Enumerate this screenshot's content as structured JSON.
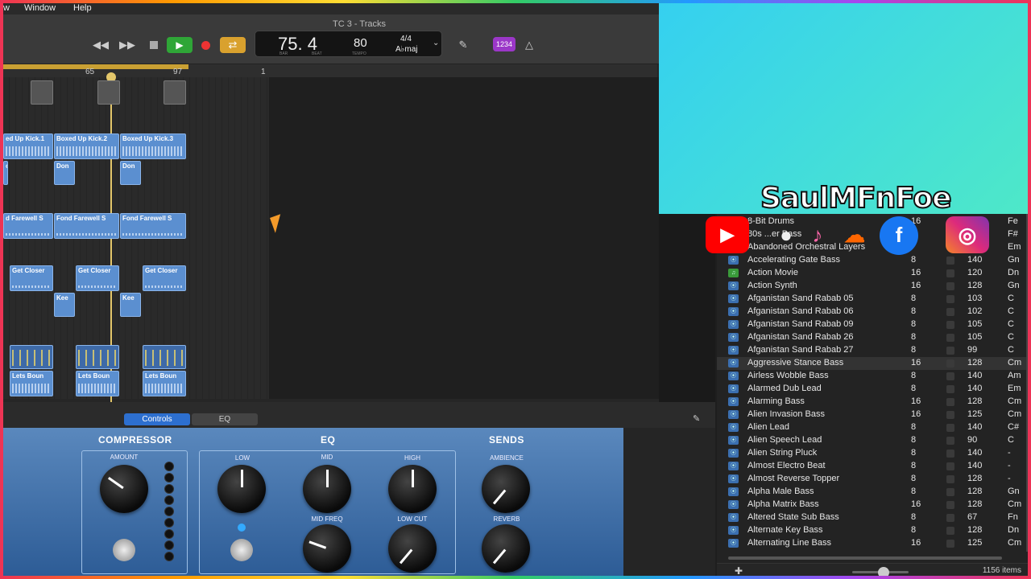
{
  "menubar": {
    "left_item": "w",
    "window": "Window",
    "help": "Help"
  },
  "window": {
    "title": "TC 3 - Tracks"
  },
  "transport": {
    "rewind": "◀◀",
    "forward": "▶▶",
    "play": "▶",
    "loop": "⇄"
  },
  "lcd": {
    "bar_beat": "75. 4",
    "bar_label": "BAR",
    "beat_label": "BEAT",
    "tempo": "80",
    "tempo_label": "TEMPO",
    "time_sig": "4/4",
    "key": "A♭maj"
  },
  "count_in": "1234",
  "ruler": {
    "marks": [
      "65",
      "97",
      "1"
    ]
  },
  "regions": {
    "kick": [
      "ed Up Kick.1",
      "Boxed Up Kick.2",
      "Boxed Up Kick.3"
    ],
    "don": [
      "o",
      "Don",
      "Don"
    ],
    "farewell": [
      "d Farewell S",
      "Fond Farewell S",
      "Fond Farewell S"
    ],
    "closer": [
      "Get Closer",
      "Get Closer",
      "Get Closer"
    ],
    "kee": [
      "Kee",
      "Kee"
    ],
    "bounce": [
      "Lets Boun",
      "Lets Boun",
      "Lets Boun"
    ]
  },
  "smart_controls": {
    "tab_controls": "Controls",
    "tab_eq": "EQ"
  },
  "plugin": {
    "compressor": "COMPRESSOR",
    "amount": "AMOUNT",
    "eq": "EQ",
    "low": "LOW",
    "mid": "MID",
    "high": "HIGH",
    "mid_freq": "MID FREQ",
    "low_cut": "LOW CUT",
    "sends": "SENDS",
    "ambience": "AMBIENCE",
    "reverb": "REVERB"
  },
  "overlay": {
    "brand": "SaulMFnFoe"
  },
  "browser": {
    "partial_rows": [
      {
        "name": "8-Bit Drums",
        "beats": "16",
        "key": "Fe"
      },
      {
        "name": "80s ...er Bass",
        "beats": "",
        "key": "F#"
      },
      {
        "name": "Abandoned Orchestral Layers",
        "beats": "",
        "key": "Em"
      }
    ],
    "rows": [
      {
        "name": "Accelerating Gate Bass",
        "beats": "8",
        "tempo": "140",
        "key": "Gn",
        "type": "audio"
      },
      {
        "name": "Action Movie",
        "beats": "16",
        "tempo": "120",
        "key": "Dn",
        "type": "midi"
      },
      {
        "name": "Action Synth",
        "beats": "16",
        "tempo": "128",
        "key": "Gn",
        "type": "audio"
      },
      {
        "name": "Afganistan Sand Rabab 05",
        "beats": "8",
        "tempo": "103",
        "key": "C",
        "type": "audio"
      },
      {
        "name": "Afganistan Sand Rabab 06",
        "beats": "8",
        "tempo": "102",
        "key": "C",
        "type": "audio"
      },
      {
        "name": "Afganistan Sand Rabab 09",
        "beats": "8",
        "tempo": "105",
        "key": "C",
        "type": "audio"
      },
      {
        "name": "Afganistan Sand Rabab 26",
        "beats": "8",
        "tempo": "105",
        "key": "C",
        "type": "audio"
      },
      {
        "name": "Afganistan Sand Rabab 27",
        "beats": "8",
        "tempo": "99",
        "key": "C",
        "type": "audio"
      },
      {
        "name": "Aggressive Stance Bass",
        "beats": "16",
        "tempo": "128",
        "key": "Cm",
        "type": "audio"
      },
      {
        "name": "Airless Wobble Bass",
        "beats": "8",
        "tempo": "140",
        "key": "Am",
        "type": "audio"
      },
      {
        "name": "Alarmed Dub Lead",
        "beats": "8",
        "tempo": "140",
        "key": "Em",
        "type": "audio"
      },
      {
        "name": "Alarming Bass",
        "beats": "16",
        "tempo": "128",
        "key": "Cm",
        "type": "audio"
      },
      {
        "name": "Alien Invasion Bass",
        "beats": "16",
        "tempo": "125",
        "key": "Cm",
        "type": "audio"
      },
      {
        "name": "Alien Lead",
        "beats": "8",
        "tempo": "140",
        "key": "C#",
        "type": "audio"
      },
      {
        "name": "Alien Speech Lead",
        "beats": "8",
        "tempo": "90",
        "key": "C",
        "type": "audio"
      },
      {
        "name": "Alien String Pluck",
        "beats": "8",
        "tempo": "140",
        "key": "-",
        "type": "audio"
      },
      {
        "name": "Almost Electro Beat",
        "beats": "8",
        "tempo": "140",
        "key": "-",
        "type": "audio"
      },
      {
        "name": "Almost Reverse Topper",
        "beats": "8",
        "tempo": "128",
        "key": "-",
        "type": "audio"
      },
      {
        "name": "Alpha Male Bass",
        "beats": "8",
        "tempo": "128",
        "key": "Gn",
        "type": "audio"
      },
      {
        "name": "Alpha Matrix Bass",
        "beats": "16",
        "tempo": "128",
        "key": "Cm",
        "type": "audio"
      },
      {
        "name": "Altered State Sub Bass",
        "beats": "8",
        "tempo": "67",
        "key": "Fn",
        "type": "audio"
      },
      {
        "name": "Alternate Key Bass",
        "beats": "8",
        "tempo": "128",
        "key": "Dn",
        "type": "audio"
      },
      {
        "name": "Alternating Line Bass",
        "beats": "16",
        "tempo": "125",
        "key": "Cm",
        "type": "audio"
      }
    ],
    "item_count": "1156 items"
  }
}
